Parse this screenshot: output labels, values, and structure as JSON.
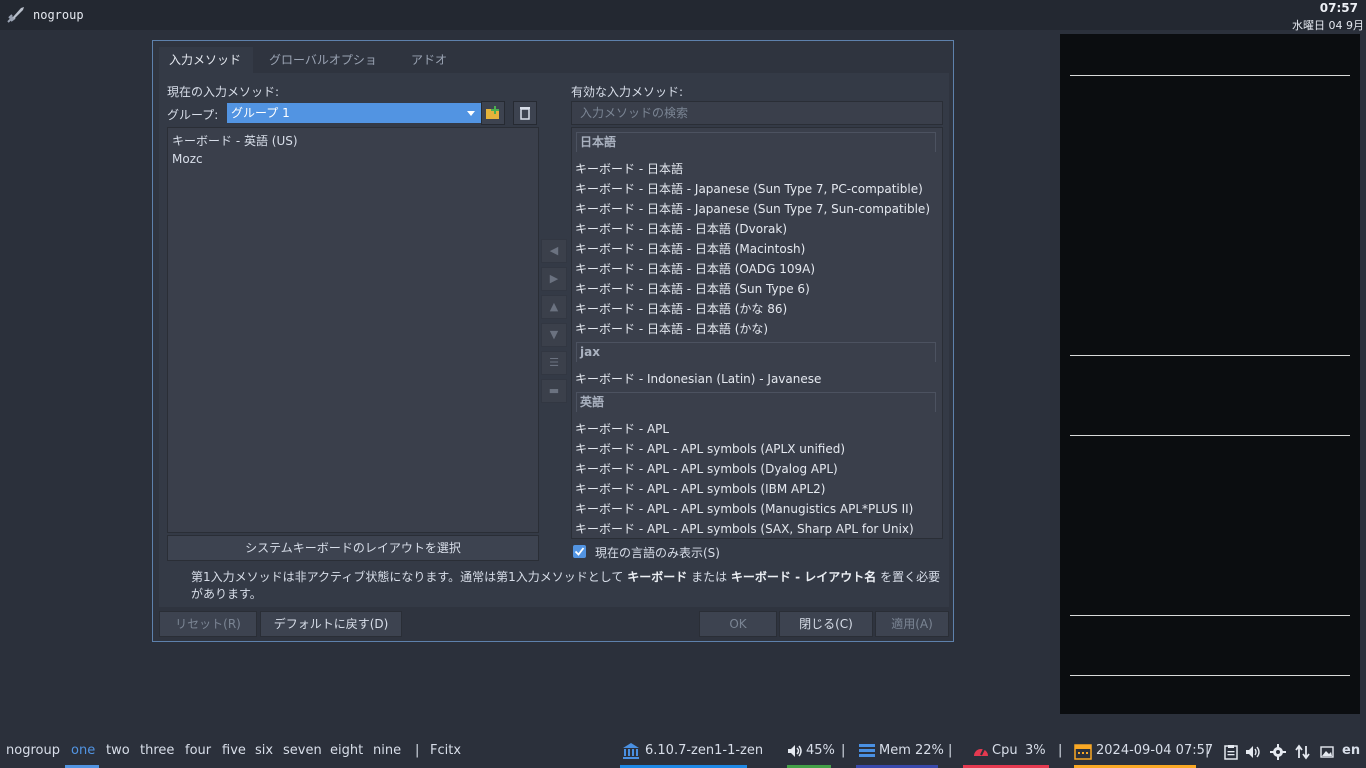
{
  "topbar": {
    "title": "nogroup",
    "time": "07:57",
    "date": "水曜日 04 9月"
  },
  "dialog": {
    "tabs": [
      "入力メソッド",
      "グローバルオプション",
      "アドオン"
    ],
    "current_label": "現在の入力メソッド:",
    "group_label": "グループ:",
    "group_value": "グループ 1",
    "current_items": [
      "キーボード - 英語 (US)",
      "Mozc"
    ],
    "syskbd_button": "システムキーボードのレイアウトを選択",
    "available_label": "有効な入力メソッド:",
    "search_placeholder": "入力メソッドの検索",
    "sections": [
      {
        "header": "日本語",
        "items": [
          "キーボード - 日本語",
          "キーボード - 日本語 - Japanese (Sun Type 7, PC-compatible)",
          "キーボード - 日本語 - Japanese (Sun Type 7, Sun-compatible)",
          "キーボード - 日本語 - 日本語 (Dvorak)",
          "キーボード - 日本語 - 日本語 (Macintosh)",
          "キーボード - 日本語 - 日本語 (OADG 109A)",
          "キーボード - 日本語 - 日本語 (Sun Type 6)",
          "キーボード - 日本語 - 日本語 (かな 86)",
          "キーボード - 日本語 - 日本語 (かな)"
        ]
      },
      {
        "header": "jax",
        "items": [
          "キーボード - Indonesian (Latin) - Javanese"
        ]
      },
      {
        "header": "英語",
        "items": [
          "キーボード - APL",
          "キーボード - APL - APL symbols (APLX unified)",
          "キーボード - APL - APL symbols (Dyalog APL)",
          "キーボード - APL - APL symbols (IBM APL2)",
          "キーボード - APL - APL symbols (Manugistics APL*PLUS II)",
          "キーボード - APL - APL symbols (SAX, Sharp APL for Unix)"
        ]
      }
    ],
    "only_current_lang": "現在の言語のみ表示(S)",
    "warning": {
      "part1": "第1入力メソッドは非アクティブ状態になります。通常は第1入力メソッドとして",
      "bold1": "キーボード",
      "part2": "または",
      "bold2": "キーボード - レイアウト名",
      "part3": "を置く必要があります。"
    },
    "buttons": {
      "reset": "リセット(R)",
      "defaults": "デフォルトに戻す(D)",
      "ok": "OK",
      "close": "閉じる(C)",
      "apply": "適用(A)"
    }
  },
  "bottombar": {
    "workspaces": [
      "nogroup",
      "one",
      "two",
      "three",
      "four",
      "five",
      "six",
      "seven",
      "eight",
      "nine"
    ],
    "active_workspace": "one",
    "app": "Fcitx",
    "kernel": "6.10.7-zen1-1-zen",
    "volume": "45%",
    "mem": "Mem 22%",
    "cpu_label": "Cpu",
    "cpu_value": "3%",
    "datetime": "2024-09-04 07:57",
    "lang": "en"
  },
  "colors": {
    "accent": "#5294e2",
    "kernel_under": "#1e88e5",
    "volume_under": "#43a047",
    "mem_under": "#3949ab",
    "cpu_under": "#e53950",
    "date_under": "#f9a825"
  }
}
